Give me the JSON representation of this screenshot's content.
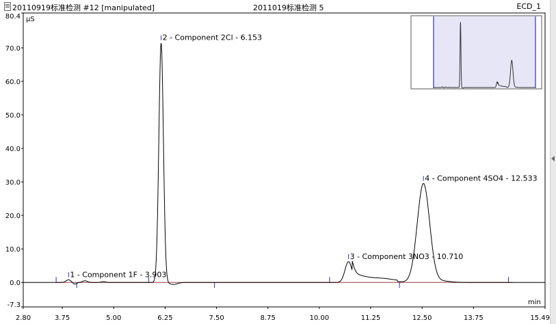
{
  "header": {
    "left_title": "20110919标准检测 #12 [manipulated]",
    "center_title": "2011019标准检测 5",
    "right_title": "ECD_1"
  },
  "chart_data": {
    "type": "line",
    "xlabel": "min",
    "ylabel": "µS",
    "xlim": [
      2.8,
      15.49
    ],
    "ylim": [
      -7.3,
      80.4
    ],
    "xticks": [
      "2.80",
      "3.75",
      "5.00",
      "6.25",
      "7.50",
      "8.75",
      "10.00",
      "11.25",
      "12.50",
      "13.75",
      "15.49"
    ],
    "yticks": [
      "80.4",
      "70.0",
      "60.0",
      "50.0",
      "40.0",
      "30.0",
      "20.0",
      "10.0",
      "0.0",
      "-7.3"
    ],
    "grid": false,
    "baseline_color": "#c00000",
    "trace_color": "#000000",
    "peaks": [
      {
        "label": "1 - Component 1F - 3.903",
        "rt": 3.903,
        "height": 0.8,
        "width": 0.06
      },
      {
        "label": "2 - Component 2Cl - 6.153",
        "rt": 6.153,
        "height": 71.5,
        "width": 0.06
      },
      {
        "label": "3 - Component 3NO3 - 10.710",
        "rt": 10.71,
        "height": 6.2,
        "width": 0.09
      },
      {
        "label": "4 - Component 4SO4 - 12.533",
        "rt": 12.533,
        "height": 29.5,
        "width": 0.16
      }
    ],
    "integration_marks": [
      3.6,
      4.1,
      5.85,
      7.45,
      10.25,
      11.95,
      14.6
    ],
    "inset": {
      "x_window": [
        2.8,
        15.49
      ]
    }
  }
}
